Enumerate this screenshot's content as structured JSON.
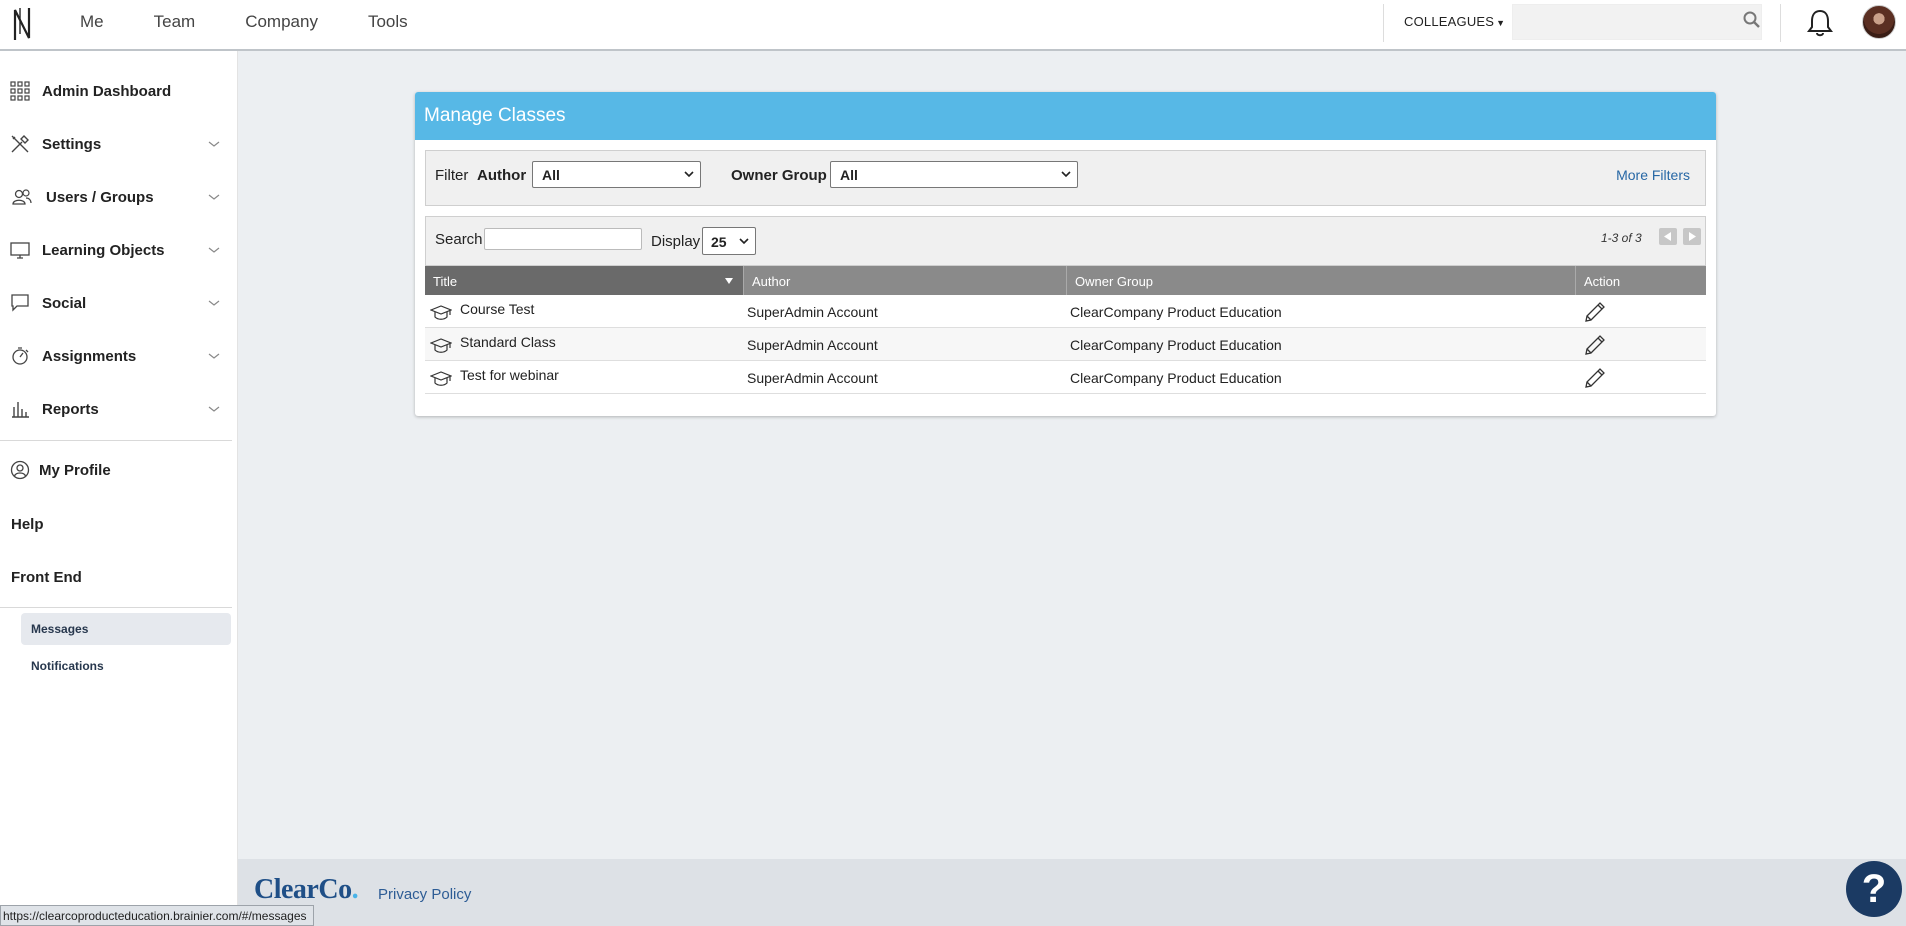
{
  "topbar": {
    "nav": [
      "Me",
      "Team",
      "Company",
      "Tools"
    ],
    "colleagues_label": "COLLEAGUES",
    "search_value": ""
  },
  "sidebar": {
    "items": [
      {
        "label": "Admin Dashboard",
        "icon": "grid-icon",
        "expandable": false
      },
      {
        "label": "Settings",
        "icon": "tools-icon",
        "expandable": true
      },
      {
        "label": "Users / Groups",
        "icon": "users-icon",
        "expandable": true
      },
      {
        "label": "Learning Objects",
        "icon": "monitor-icon",
        "expandable": true
      },
      {
        "label": "Social",
        "icon": "chat-bubble-icon",
        "expandable": true
      },
      {
        "label": "Assignments",
        "icon": "stopwatch-icon",
        "expandable": true
      },
      {
        "label": "Reports",
        "icon": "bar-chart-icon",
        "expandable": true
      }
    ],
    "my_profile": "My Profile",
    "help": "Help",
    "front_end": "Front End",
    "sub_items": [
      {
        "label": "Messages",
        "active": true
      },
      {
        "label": "Notifications",
        "active": false
      }
    ]
  },
  "panel": {
    "title": "Manage Classes",
    "filter": {
      "label": "Filter",
      "author_label": "Author",
      "author_value": "All",
      "owner_group_label": "Owner Group",
      "owner_group_value": "All",
      "more_filters": "More Filters"
    },
    "search": {
      "label": "Search",
      "value": "",
      "display_label": "Display",
      "display_value": "25",
      "count": "1-3 of 3"
    },
    "table": {
      "columns": [
        "Title",
        "Author",
        "Owner Group",
        "Action"
      ],
      "rows": [
        {
          "title": "Course Test",
          "author": "SuperAdmin Account",
          "owner_group": "ClearCompany Product Education"
        },
        {
          "title": "Standard Class",
          "author": "SuperAdmin Account",
          "owner_group": "ClearCompany Product Education"
        },
        {
          "title": "Test for webinar",
          "author": "SuperAdmin Account",
          "owner_group": "ClearCompany Product Education"
        }
      ]
    }
  },
  "footer": {
    "brand": "ClearCo",
    "brand_dot": ".",
    "privacy": "Privacy Policy",
    "help_symbol": "?"
  },
  "status_url": "https://clearcoproducteducation.brainier.com/#/messages",
  "colors": {
    "header_blue": "#57b8e6",
    "brand_navy": "#1f4f87",
    "link": "#2767a5",
    "table_header": "#8a8a8a"
  }
}
